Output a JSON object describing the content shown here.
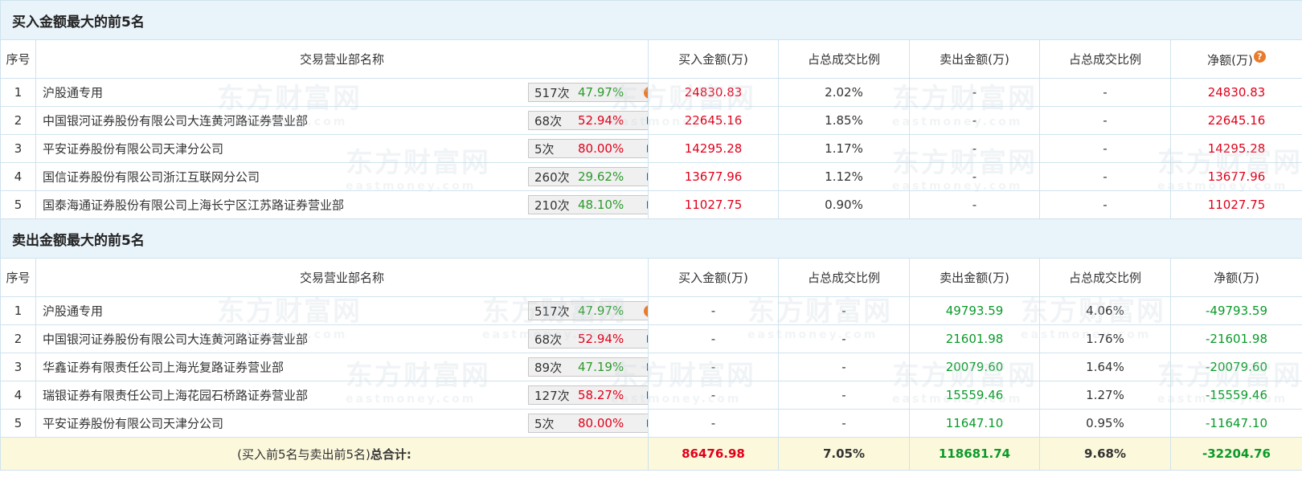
{
  "buy_section": {
    "title": "买入金额最大的前5名",
    "headers": [
      "序号",
      "交易营业部名称",
      "买入金额(万)",
      "占总成交比例",
      "卖出金额(万)",
      "占总成交比例",
      "净额(万)"
    ],
    "help_icon": "?",
    "rows": [
      {
        "idx": "1",
        "name": "沪股通专用",
        "count": "517次",
        "pct": "47.97%",
        "pct_color": "green",
        "icon": "question-icon",
        "buy": "24830.83",
        "buy_ratio": "2.02%",
        "sell": "-",
        "sell_ratio": "-",
        "net": "24830.83"
      },
      {
        "idx": "2",
        "name": "中国银河证券股份有限公司大连黄河路证券营业部",
        "count": "68次",
        "pct": "52.94%",
        "pct_color": "red",
        "icon": "arrow-right-icon",
        "buy": "22645.16",
        "buy_ratio": "1.85%",
        "sell": "-",
        "sell_ratio": "-",
        "net": "22645.16"
      },
      {
        "idx": "3",
        "name": "平安证券股份有限公司天津分公司",
        "count": "5次",
        "pct": "80.00%",
        "pct_color": "red",
        "icon": "arrow-right-icon",
        "buy": "14295.28",
        "buy_ratio": "1.17%",
        "sell": "-",
        "sell_ratio": "-",
        "net": "14295.28"
      },
      {
        "idx": "4",
        "name": "国信证券股份有限公司浙江互联网分公司",
        "count": "260次",
        "pct": "29.62%",
        "pct_color": "green",
        "icon": "arrow-right-icon",
        "buy": "13677.96",
        "buy_ratio": "1.12%",
        "sell": "-",
        "sell_ratio": "-",
        "net": "13677.96"
      },
      {
        "idx": "5",
        "name": "国泰海通证券股份有限公司上海长宁区江苏路证券营业部",
        "count": "210次",
        "pct": "48.10%",
        "pct_color": "green",
        "icon": "arrow-right-icon",
        "buy": "11027.75",
        "buy_ratio": "0.90%",
        "sell": "-",
        "sell_ratio": "-",
        "net": "11027.75"
      }
    ]
  },
  "sell_section": {
    "title": "卖出金额最大的前5名",
    "headers": [
      "序号",
      "交易营业部名称",
      "买入金额(万)",
      "占总成交比例",
      "卖出金额(万)",
      "占总成交比例",
      "净额(万)"
    ],
    "rows": [
      {
        "idx": "1",
        "name": "沪股通专用",
        "count": "517次",
        "pct": "47.97%",
        "pct_color": "green",
        "icon": "question-icon",
        "buy": "-",
        "buy_ratio": "-",
        "sell": "49793.59",
        "sell_ratio": "4.06%",
        "net": "-49793.59"
      },
      {
        "idx": "2",
        "name": "中国银河证券股份有限公司大连黄河路证券营业部",
        "count": "68次",
        "pct": "52.94%",
        "pct_color": "red",
        "icon": "arrow-right-icon",
        "buy": "-",
        "buy_ratio": "-",
        "sell": "21601.98",
        "sell_ratio": "1.76%",
        "net": "-21601.98"
      },
      {
        "idx": "3",
        "name": "华鑫证券有限责任公司上海光复路证券营业部",
        "count": "89次",
        "pct": "47.19%",
        "pct_color": "green",
        "icon": "arrow-right-icon",
        "buy": "-",
        "buy_ratio": "-",
        "sell": "20079.60",
        "sell_ratio": "1.64%",
        "net": "-20079.60"
      },
      {
        "idx": "4",
        "name": "瑞银证券有限责任公司上海花园石桥路证券营业部",
        "count": "127次",
        "pct": "58.27%",
        "pct_color": "red",
        "icon": "arrow-right-icon",
        "buy": "-",
        "buy_ratio": "-",
        "sell": "15559.46",
        "sell_ratio": "1.27%",
        "net": "-15559.46"
      },
      {
        "idx": "5",
        "name": "平安证券股份有限公司天津分公司",
        "count": "5次",
        "pct": "80.00%",
        "pct_color": "red",
        "icon": "arrow-right-icon",
        "buy": "-",
        "buy_ratio": "-",
        "sell": "11647.10",
        "sell_ratio": "0.95%",
        "net": "-11647.10"
      }
    ]
  },
  "total": {
    "label_prefix": "(买入前5名与卖出前5名)",
    "label_bold": "总合计:",
    "buy": "86476.98",
    "buy_ratio": "7.05%",
    "sell": "118681.74",
    "sell_ratio": "9.68%",
    "net": "-32204.76"
  },
  "watermark": {
    "cn": "东方财富网",
    "en": "eastmoney.com"
  },
  "colors": {
    "red": "#e1001a",
    "green": "#0a9a2a",
    "header_bg": "#e9f3fa",
    "total_bg": "#fcf8dc"
  }
}
